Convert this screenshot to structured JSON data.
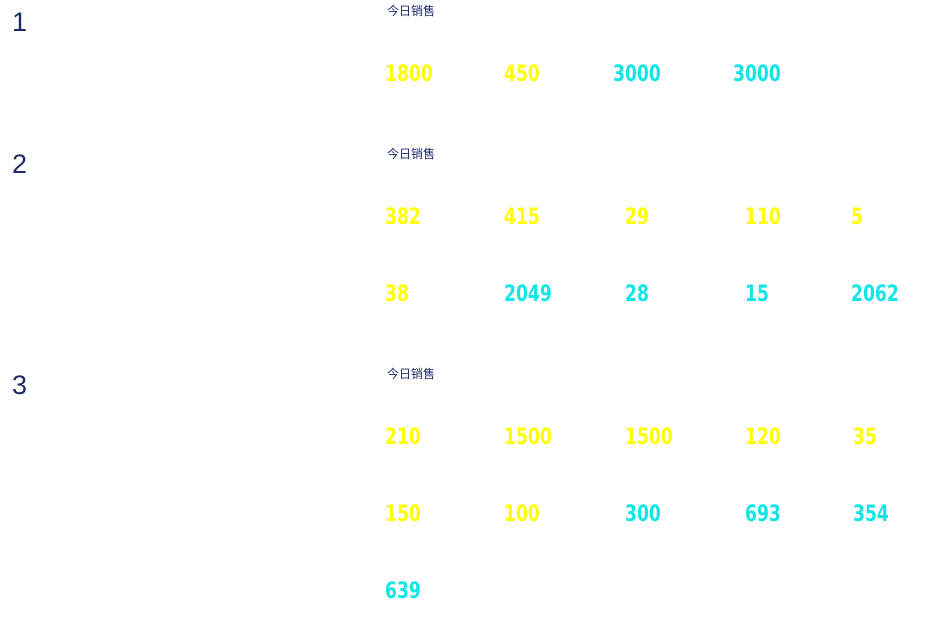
{
  "colors": {
    "yellow": "#ffff00",
    "cyan": "#11e6e6",
    "label": "#1e2a6a"
  },
  "sections": [
    {
      "number": "1",
      "label": "今日销售",
      "rows": [
        [
          {
            "value": "1800",
            "color": "yellow"
          },
          {
            "value": "450",
            "color": "yellow"
          },
          {
            "value": "3000",
            "color": "cyan"
          },
          {
            "value": "3000",
            "color": "cyan"
          }
        ]
      ]
    },
    {
      "number": "2",
      "label": "今日销售",
      "rows": [
        [
          {
            "value": "382",
            "color": "yellow"
          },
          {
            "value": "415",
            "color": "yellow"
          },
          {
            "value": "29",
            "color": "yellow"
          },
          {
            "value": "110",
            "color": "yellow"
          },
          {
            "value": "5",
            "color": "yellow"
          }
        ],
        [
          {
            "value": "38",
            "color": "yellow"
          },
          {
            "value": "2049",
            "color": "cyan"
          },
          {
            "value": "28",
            "color": "cyan"
          },
          {
            "value": "15",
            "color": "cyan"
          },
          {
            "value": "2062",
            "color": "cyan"
          }
        ]
      ]
    },
    {
      "number": "3",
      "label": "今日销售",
      "rows": [
        [
          {
            "value": "210",
            "color": "yellow"
          },
          {
            "value": "1500",
            "color": "yellow"
          },
          {
            "value": "1500",
            "color": "yellow"
          },
          {
            "value": "120",
            "color": "yellow"
          },
          {
            "value": "35",
            "color": "yellow"
          }
        ],
        [
          {
            "value": "150",
            "color": "yellow"
          },
          {
            "value": "100",
            "color": "yellow"
          },
          {
            "value": "300",
            "color": "cyan"
          },
          {
            "value": "693",
            "color": "cyan"
          },
          {
            "value": "354",
            "color": "cyan"
          }
        ],
        [
          {
            "value": "639",
            "color": "cyan"
          }
        ]
      ]
    }
  ]
}
